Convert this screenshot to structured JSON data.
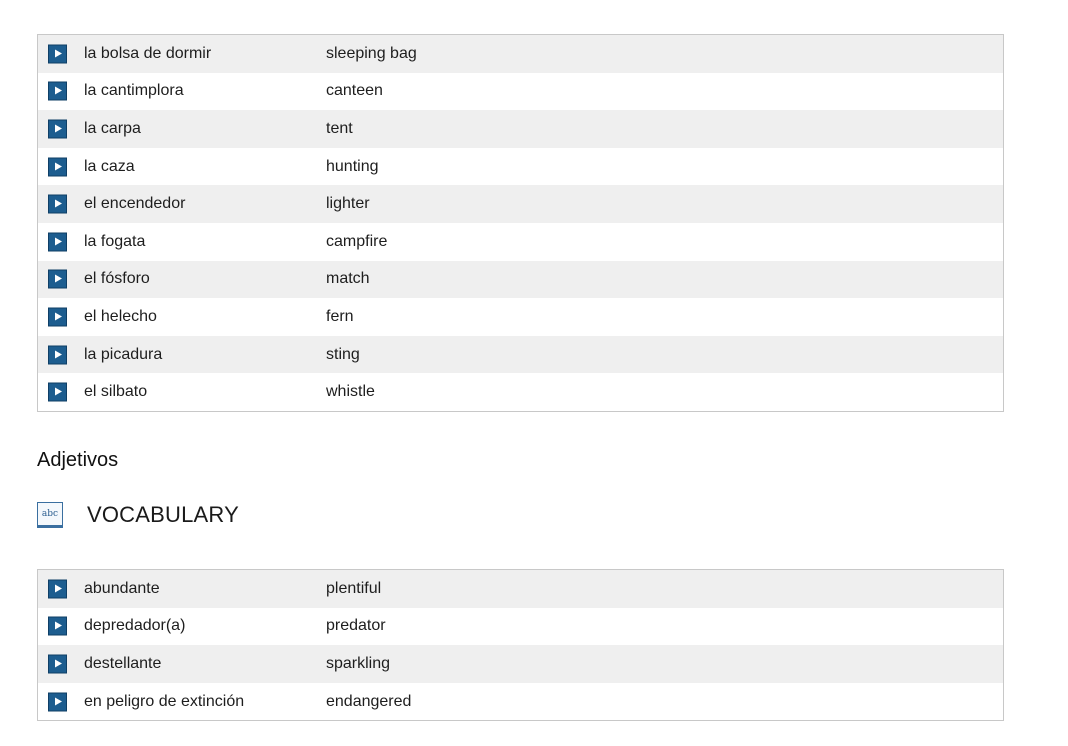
{
  "table_1": {
    "rows": [
      {
        "term": "la bolsa de dormir",
        "translation": "sleeping bag"
      },
      {
        "term": "la cantimplora",
        "translation": "canteen"
      },
      {
        "term": "la carpa",
        "translation": "tent"
      },
      {
        "term": "la caza",
        "translation": "hunting"
      },
      {
        "term": "el encendedor",
        "translation": "lighter"
      },
      {
        "term": "la fogata",
        "translation": "campfire"
      },
      {
        "term": "el fósforo",
        "translation": "match"
      },
      {
        "term": "el helecho",
        "translation": "fern"
      },
      {
        "term": "la picadura",
        "translation": "sting"
      },
      {
        "term": "el silbato",
        "translation": "whistle"
      }
    ]
  },
  "section": {
    "heading": "Adjetivos",
    "vocab_title": "VOCABULARY",
    "vocab_icon_label": "abc",
    "vocab_icon_name": "vocabulary-book-icon"
  },
  "table_2": {
    "rows": [
      {
        "term": "abundante",
        "translation": "plentiful"
      },
      {
        "term": "depredador(a)",
        "translation": "predator"
      },
      {
        "term": "destellante",
        "translation": "sparkling"
      },
      {
        "term": "en peligro de extinción",
        "translation": "endangered"
      }
    ]
  },
  "play_button_icon": "play-icon",
  "colors": {
    "play_button": "#1d5d8f",
    "row_odd": "#efefef",
    "row_even": "#ffffff",
    "border": "#c8c8c8"
  }
}
